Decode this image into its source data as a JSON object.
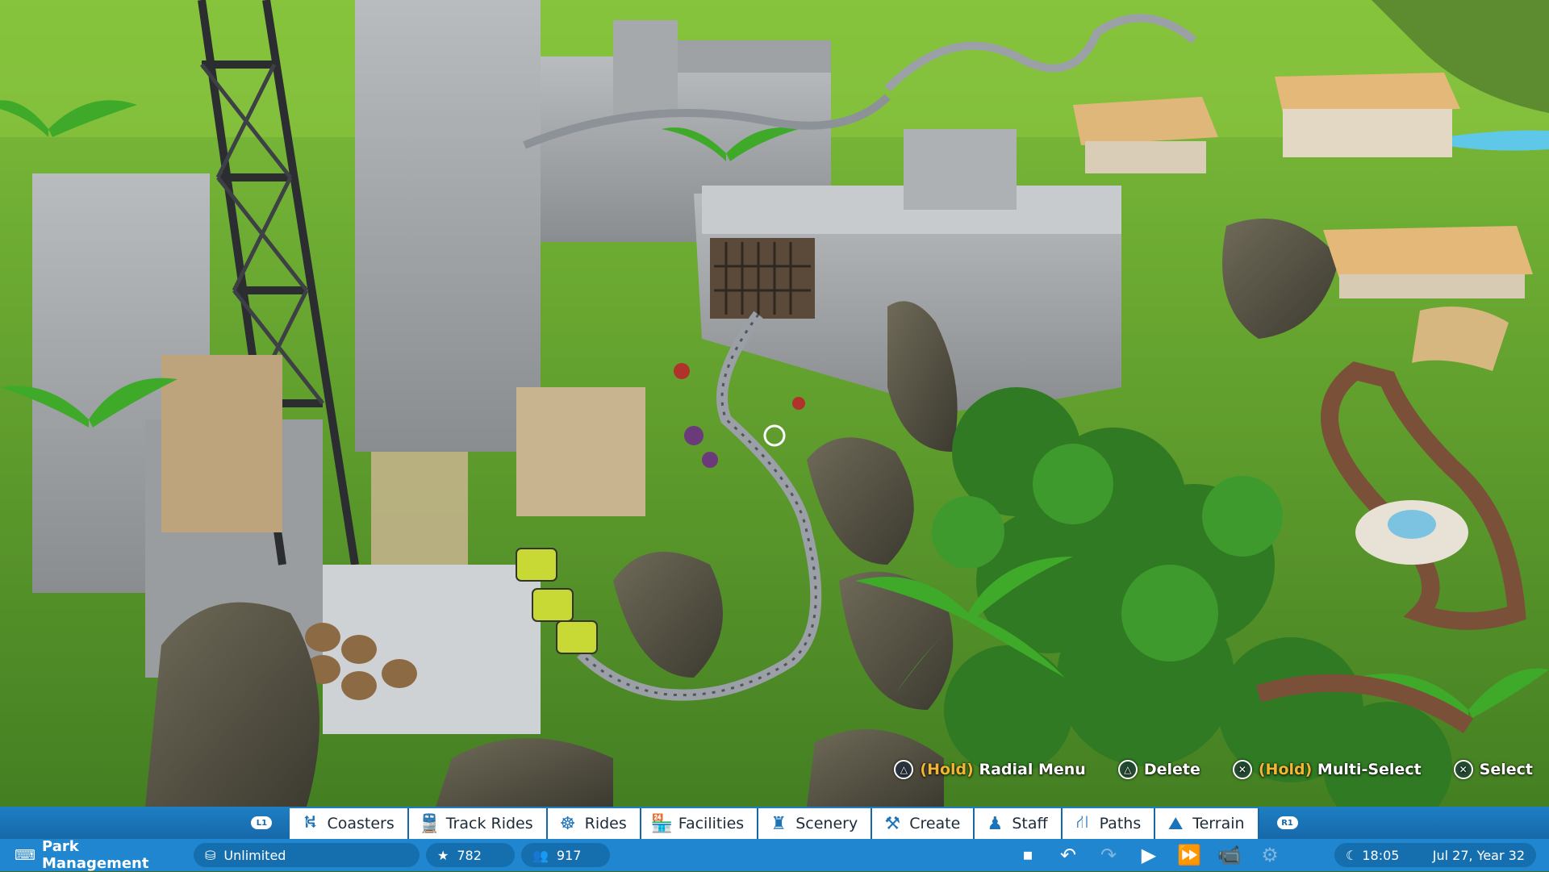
{
  "prompts": [
    {
      "button": "triangle",
      "glyph": "△",
      "hold": "(Hold)",
      "label": "Radial Menu"
    },
    {
      "button": "triangle",
      "glyph": "△",
      "hold": "",
      "label": "Delete"
    },
    {
      "button": "cross",
      "glyph": "✕",
      "hold": "(Hold)",
      "label": "Multi-Select"
    },
    {
      "button": "cross",
      "glyph": "✕",
      "hold": "",
      "label": "Select"
    }
  ],
  "tabbar": {
    "left_shoulder": "L1",
    "right_shoulder": "R1",
    "tabs": [
      {
        "icon": "coaster-icon",
        "glyph": "⛕",
        "label": "Coasters"
      },
      {
        "icon": "train-icon",
        "glyph": "🚆",
        "label": "Track Rides"
      },
      {
        "icon": "ferris-wheel-icon",
        "glyph": "☸",
        "label": "Rides"
      },
      {
        "icon": "shop-icon",
        "glyph": "🏪",
        "label": "Facilities"
      },
      {
        "icon": "tower-icon",
        "glyph": "♜",
        "label": "Scenery"
      },
      {
        "icon": "tools-icon",
        "glyph": "⚒",
        "label": "Create"
      },
      {
        "icon": "staff-icon",
        "glyph": "♟",
        "label": "Staff"
      },
      {
        "icon": "path-icon",
        "glyph": "⛙",
        "label": "Paths"
      },
      {
        "icon": "terrain-icon",
        "glyph": "⛰",
        "label": "Terrain"
      }
    ]
  },
  "status": {
    "park_management": "Park Management",
    "money": "Unlimited",
    "rating": "782",
    "guests": "917",
    "time": "18:05",
    "date": "Jul 27, Year 32"
  },
  "colors": {
    "toolbar_blue": "#1e7fc4",
    "status_blue": "#1f86cf",
    "hold_accent": "#f2b632"
  }
}
